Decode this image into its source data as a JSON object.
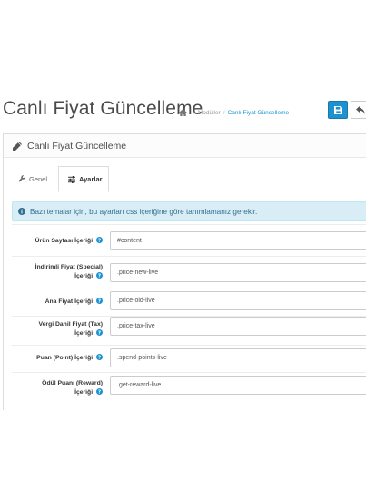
{
  "header": {
    "title": "Canlı Fiyat Güncelleme",
    "breadcrumb": [
      "Modüller",
      "Canlı Fiyat Güncelleme"
    ],
    "save_icon": "save-icon",
    "back_icon": "reply-icon"
  },
  "panel": {
    "title": "Canlı Fiyat Güncelleme",
    "tabs": [
      {
        "label": "Genel",
        "icon": "wrench-icon",
        "active": false
      },
      {
        "label": "Ayarlar",
        "icon": "sliders-icon",
        "active": true
      }
    ]
  },
  "alert": {
    "text": "Bazı temalar için, bu ayarları css içeriğine göre tanımlamanız gerekir."
  },
  "fields": [
    {
      "label_line1": "Ürün Sayfası İçeriği",
      "label_line2": "",
      "value": "#content"
    },
    {
      "label_line1": "İndirimli Fiyat (Special)",
      "label_line2": "İçeriği",
      "value": ".price-new-live"
    },
    {
      "label_line1": "Ana Fiyat İçeriği",
      "label_line2": "",
      "value": ".price-old-live"
    },
    {
      "label_line1": "Vergi Dahil Fiyat (Tax)",
      "label_line2": "İçeriği",
      "value": ".price-tax-live"
    },
    {
      "label_line1": "Puan (Point) İçeriği",
      "label_line2": "",
      "value": ".spend-points-live"
    },
    {
      "label_line1": "Ödül Puanı (Reward)",
      "label_line2": "İçeriği",
      "value": ".get-reward-live"
    }
  ],
  "colors": {
    "primary": "#1e91cf",
    "alert_bg": "#d9edf7",
    "alert_text": "#31708f"
  }
}
